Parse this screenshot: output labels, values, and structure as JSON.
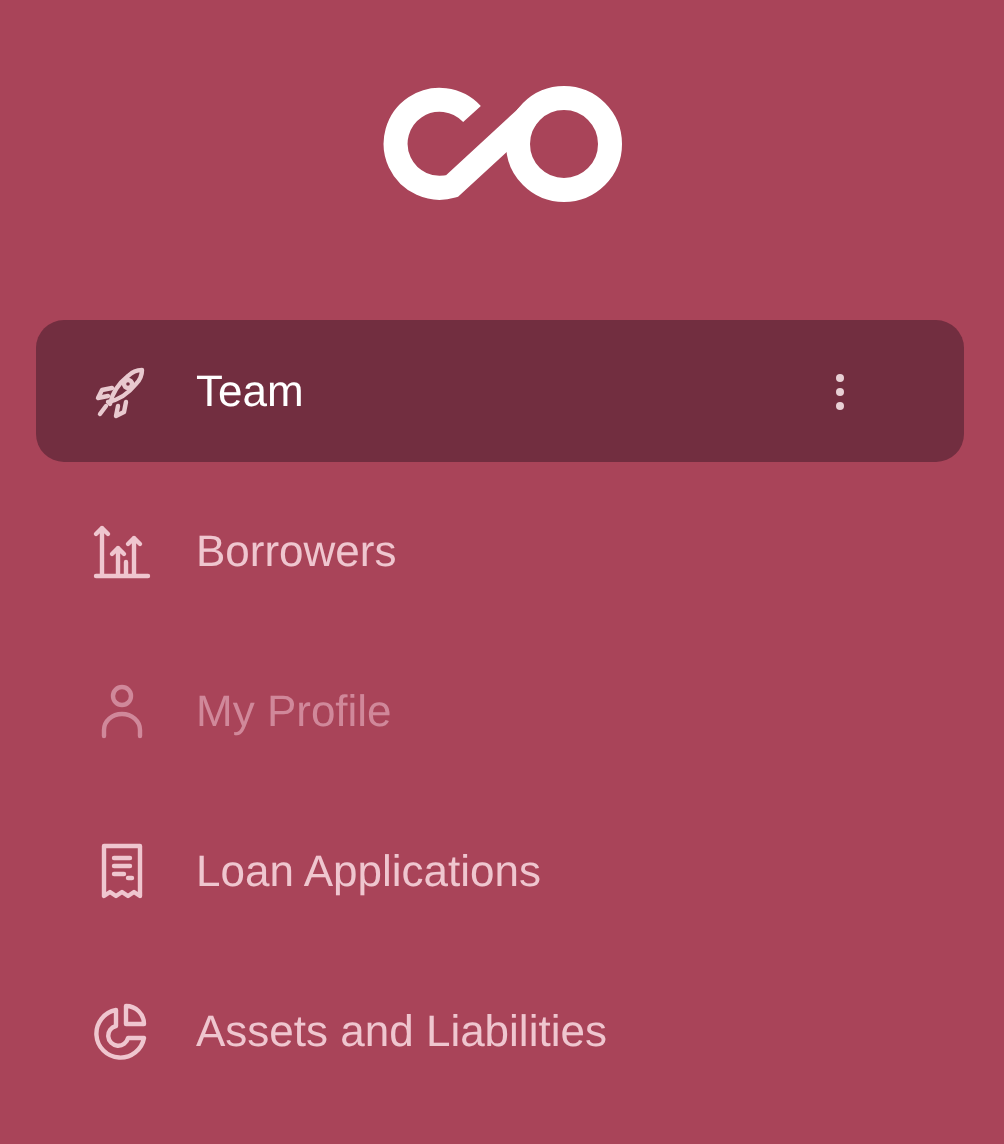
{
  "sidebar": {
    "items": [
      {
        "label": "Team",
        "kind": "rocket",
        "selected": true,
        "disabled": false
      },
      {
        "label": "Borrowers",
        "kind": "growth",
        "selected": false,
        "disabled": false
      },
      {
        "label": "My Profile",
        "kind": "user",
        "selected": false,
        "disabled": true
      },
      {
        "label": "Loan Applications",
        "kind": "receipt",
        "selected": false,
        "disabled": false
      },
      {
        "label": "Assets and Liabilities",
        "kind": "pie",
        "selected": false,
        "disabled": false
      }
    ]
  }
}
